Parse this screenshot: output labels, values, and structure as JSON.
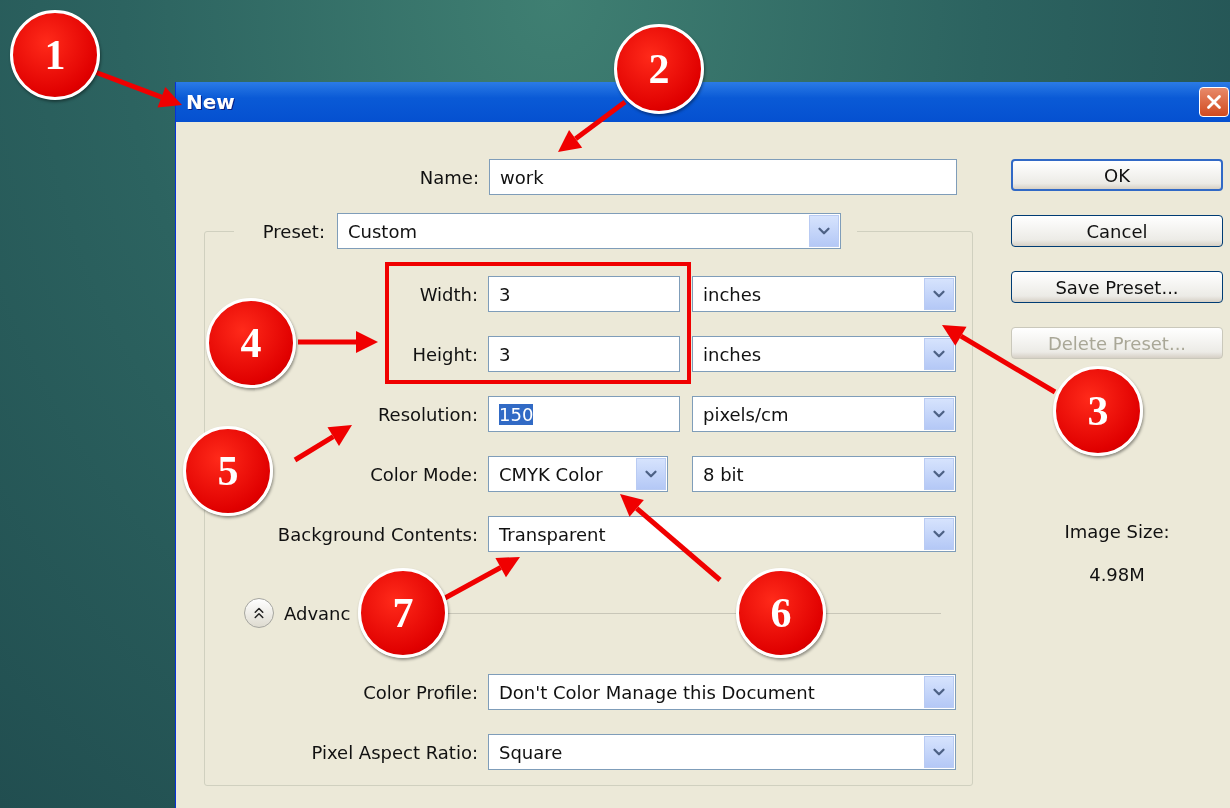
{
  "window": {
    "title": "New"
  },
  "name_field": {
    "label": "Name:",
    "value": "work"
  },
  "preset": {
    "label": "Preset:",
    "value": "Custom"
  },
  "fields": [
    {
      "kind": "measure",
      "label": "Width:",
      "value": "3",
      "text_selected": false,
      "unit": "inches"
    },
    {
      "kind": "measure",
      "label": "Height:",
      "value": "3",
      "text_selected": false,
      "unit": "inches"
    },
    {
      "kind": "measure",
      "label": "Resolution:",
      "value": "150",
      "text_selected": true,
      "unit": "pixels/cm"
    },
    {
      "kind": "pair",
      "label": "Color Mode:",
      "value": "CMYK Color",
      "unit": "8 bit"
    },
    {
      "kind": "select",
      "label": "Background Contents:",
      "value": "Transparent"
    }
  ],
  "advanced": {
    "label": "Advanc",
    "expanded": true
  },
  "advanced_fields": [
    {
      "label": "Color Profile:",
      "value": "Don't Color Manage this Document"
    },
    {
      "label": "Pixel Aspect Ratio:",
      "value": "Square"
    }
  ],
  "buttons": [
    {
      "label": "OK",
      "default": true,
      "disabled": false
    },
    {
      "label": "Cancel",
      "default": false,
      "disabled": false
    },
    {
      "label": "Save Preset...",
      "default": false,
      "disabled": false
    },
    {
      "label": "Delete Preset...",
      "default": false,
      "disabled": true
    }
  ],
  "image_size": {
    "label": "Image Size:",
    "value": "4.98M"
  },
  "annotations": [
    {
      "number": "1"
    },
    {
      "number": "2"
    },
    {
      "number": "3"
    },
    {
      "number": "4"
    },
    {
      "number": "5"
    },
    {
      "number": "6"
    },
    {
      "number": "7"
    }
  ]
}
